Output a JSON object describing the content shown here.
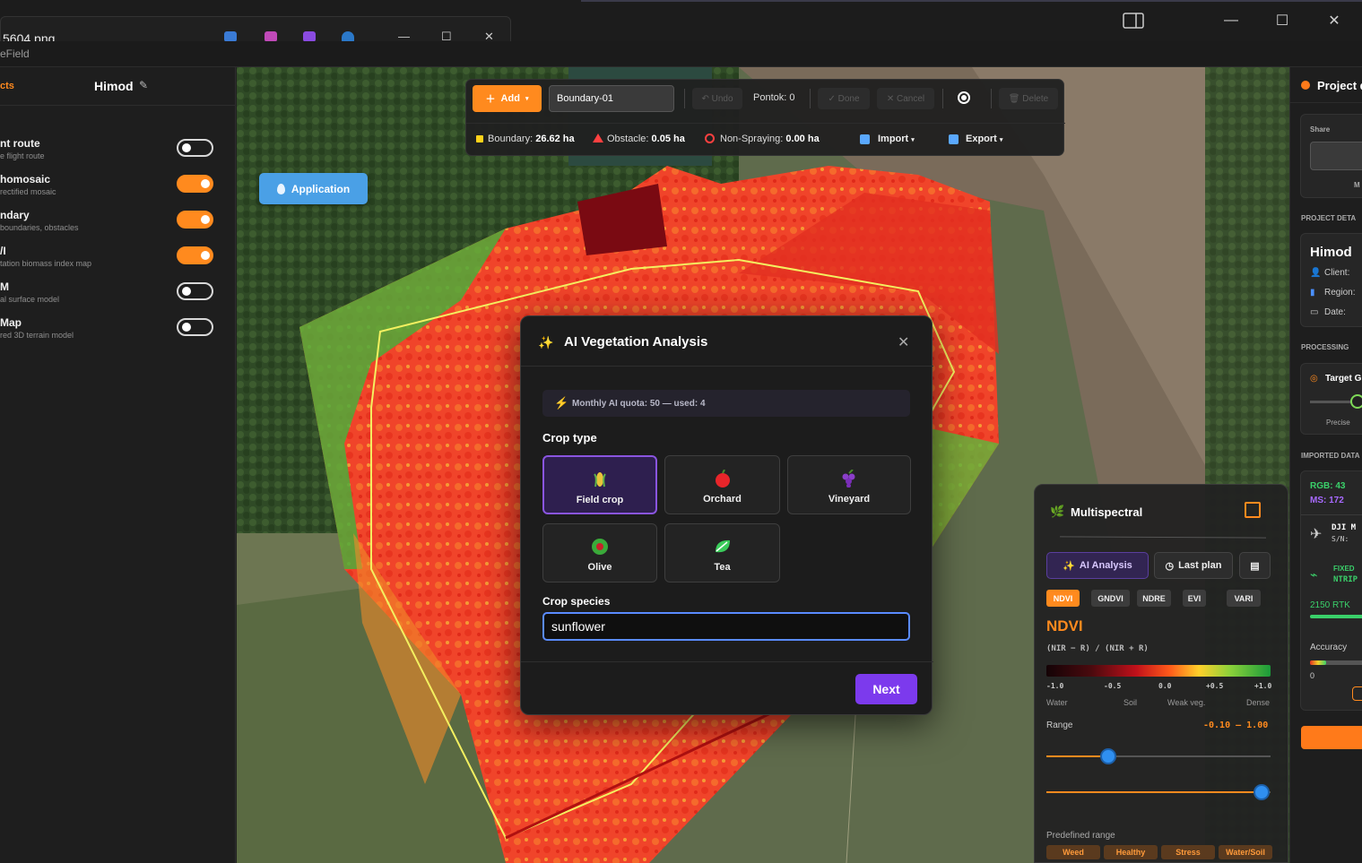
{
  "window": {
    "inner_title": "5604.png",
    "app_name": "eField",
    "controls": {
      "minimize": "—",
      "maximize": "☐",
      "close": "✕"
    }
  },
  "sidebar": {
    "tab_label": "cts",
    "project_name": "Himod",
    "layers": [
      {
        "name": "nt route",
        "sub": "e flight route",
        "on": false
      },
      {
        "name": "homosaic",
        "sub": "rectified mosaic",
        "on": true
      },
      {
        "name": "ndary",
        "sub": "boundaries, obstacles",
        "on": true
      },
      {
        "name": "/I",
        "sub": "tation biomass index map",
        "on": true
      },
      {
        "name": "M",
        "sub": "al surface model",
        "on": false
      },
      {
        "name": "Map",
        "sub": "red 3D terrain model",
        "on": false
      }
    ]
  },
  "map": {
    "application_button": "Application"
  },
  "toolbar": {
    "add_label": "Add",
    "boundary_name": "Boundary-01",
    "undo": "Undo",
    "points": "Pontok: 0",
    "done": "Done",
    "cancel": "Cancel",
    "delete": "Delete",
    "stats": {
      "boundary_label": "Boundary:",
      "boundary_value": "26.62 ha",
      "obstacle_label": "Obstacle:",
      "obstacle_value": "0.05 ha",
      "nonspray_label": "Non-Spraying:",
      "nonspray_value": "0.00 ha"
    },
    "import": "Import",
    "export": "Export"
  },
  "modal": {
    "title": "AI Vegetation Analysis",
    "quota": "Monthly AI quota: 50 — used: 4",
    "crop_type_label": "Crop type",
    "crops": [
      {
        "label": "Field crop",
        "icon": "corn-icon",
        "selected": true
      },
      {
        "label": "Orchard",
        "icon": "apple-icon",
        "selected": false
      },
      {
        "label": "Vineyard",
        "icon": "grapes-icon",
        "selected": false
      },
      {
        "label": "Olive",
        "icon": "olive-icon",
        "selected": false
      },
      {
        "label": "Tea",
        "icon": "tea-leaf-icon",
        "selected": false
      }
    ],
    "species_label": "Crop species",
    "species_value": "sunflower",
    "next": "Next"
  },
  "multispectral": {
    "title": "Multispectral",
    "ai_analysis": "AI Analysis",
    "last_plan": "Last plan",
    "indices": [
      "NDVI",
      "GNDVI",
      "NDRE",
      "EVI",
      "VARI"
    ],
    "active_index": "NDVI",
    "index_title": "NDVI",
    "formula": "(NIR − R) / (NIR + R)",
    "ticks": [
      "-1.0",
      "-0.5",
      "0.0",
      "+0.5",
      "+1.0"
    ],
    "tick_names": [
      "Water",
      "Soil",
      "Weak veg.",
      "Dense"
    ],
    "range_label": "Range",
    "range_value": "-0.10 – 1.00",
    "range_min": -0.1,
    "range_max": 1.0,
    "predefined_label": "Predefined range",
    "presets": [
      "Weed",
      "Healthy",
      "Stress",
      "Water/Soil"
    ],
    "colors": {
      "accent": "#ff8a1e",
      "ai": "#7c3aed"
    }
  },
  "right_panel": {
    "title": "Project d",
    "share": "Share",
    "share_m": "M",
    "project_details": "PROJECT DETA",
    "project_name": "Himod",
    "client": "Client:",
    "region": "Region:",
    "date": "Date:",
    "processing": "PROCESSING",
    "target": "Target G",
    "precise": "Precise",
    "imported": "IMPORTED DATA",
    "rgb": "RGB: 43",
    "ms": "MS: 172",
    "drone": "DJI M",
    "serial": "S/N:",
    "fixed": "FIXED",
    "ntrip": "NTRIP",
    "rtk": "2150 RTK",
    "accuracy": "Accuracy",
    "zero": "0"
  }
}
